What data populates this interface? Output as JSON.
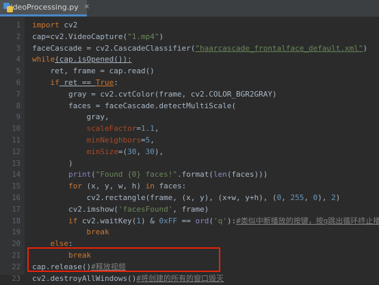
{
  "tab": {
    "filename": "videoProcessing.py",
    "close": "✕"
  },
  "lines": [
    {
      "n": "1"
    },
    {
      "n": "2"
    },
    {
      "n": "3"
    },
    {
      "n": "4"
    },
    {
      "n": "5"
    },
    {
      "n": "6"
    },
    {
      "n": "7"
    },
    {
      "n": "8"
    },
    {
      "n": "9"
    },
    {
      "n": "10"
    },
    {
      "n": "11"
    },
    {
      "n": "12"
    },
    {
      "n": "13"
    },
    {
      "n": "14"
    },
    {
      "n": "15"
    },
    {
      "n": "16"
    },
    {
      "n": "17"
    },
    {
      "n": "18"
    },
    {
      "n": "19"
    },
    {
      "n": "20"
    },
    {
      "n": "21"
    },
    {
      "n": "22"
    },
    {
      "n": "23"
    }
  ],
  "code": {
    "l1": [
      "import",
      " cv2"
    ],
    "l2": [
      "cap=cv2.VideoCapture(",
      "\"1.mp4\"",
      ")"
    ],
    "l3": [
      "faceCascade = cv2.CascadeClassifier(",
      "\"haarcascade_frontalface_default.xml\"",
      ")"
    ],
    "l4": [
      "while",
      "(cap.isOpened()):"
    ],
    "l5": [
      "    ret, frame = cap.read()"
    ],
    "l6": [
      "    ",
      "if",
      " ret == ",
      "True",
      ":"
    ],
    "l7": [
      "        gray = cv2.cvtColor(frame, cv2.COLOR_BGR2GRAY)"
    ],
    "l8": [
      "        faces = faceCascade.detectMultiScale("
    ],
    "l9": [
      "            gray,"
    ],
    "l10": [
      "            ",
      "scaleFactor",
      "=",
      "1.1",
      ","
    ],
    "l11": [
      "            ",
      "minNeighbors",
      "=",
      "5",
      ","
    ],
    "l12": [
      "            ",
      "minSize",
      "=(",
      "30",
      ", ",
      "30",
      "),"
    ],
    "l13": [
      "        )"
    ],
    "l14": [
      "        ",
      "print",
      "(",
      "\"Found {0} faces!\"",
      ".format(",
      "len",
      "(faces)))"
    ],
    "l15": [
      "        ",
      "for",
      " (x, y, w, h) ",
      "in",
      " faces:"
    ],
    "l16": [
      "            cv2.rectangle(frame, (x, y), (x+w, y+h), (",
      "0",
      ", ",
      "255",
      ", ",
      "0",
      "), ",
      "2",
      ")"
    ],
    "l17": [
      "        cv2.imshow(",
      "'facesFound'",
      ", frame)"
    ],
    "l18": [
      "        ",
      "if",
      " cv2.waitKey(",
      "1",
      ") & ",
      "0xFF",
      " == ",
      "ord",
      "(",
      "'q'",
      "):",
      "#类似中断播放的按键，按q跳出循环终止播放"
    ],
    "l19": [
      "            ",
      "break"
    ],
    "l20": [
      "    ",
      "else",
      ":"
    ],
    "l21": [
      "        ",
      "break"
    ],
    "l22": [
      "cap.release()",
      "#释放视频"
    ],
    "l23": [
      "cv2.destroyAllWindows()",
      "#将创建的所有的窗口毁灭"
    ]
  },
  "colors": {
    "keyword": "#cc7832",
    "string": "#6a8759",
    "number": "#6897bb",
    "param": "#aa4926",
    "comment": "#808080",
    "builtin": "#8888c6",
    "highlight": "#e8230b"
  }
}
